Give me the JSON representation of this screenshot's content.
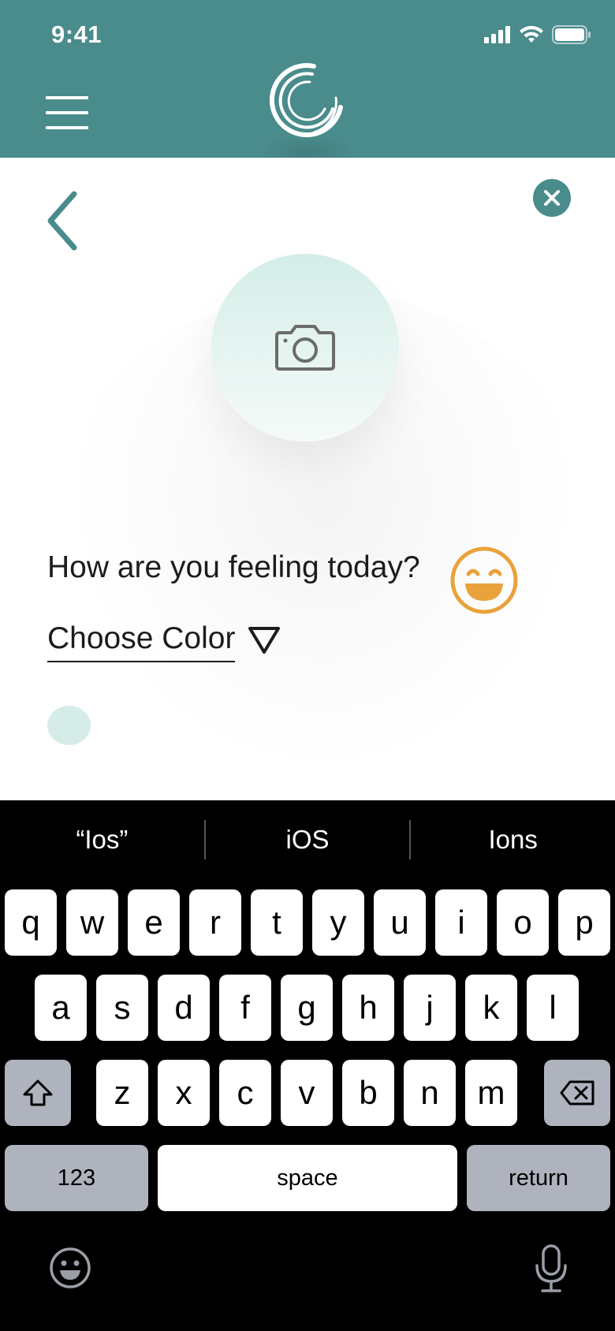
{
  "status_bar": {
    "time": "9:41",
    "icons": [
      "signal-icon",
      "wifi-icon",
      "battery-icon"
    ]
  },
  "header": {
    "menu_icon": "hamburger-menu-icon",
    "logo_icon": "swirl-logo-icon"
  },
  "colors": {
    "header_bg": "#4a8b8c",
    "accent_teal": "#4a8b8c",
    "photo_circle": "#d4ede8",
    "emoji_orange": "#e9a23b",
    "color_dot": "#d6ece8",
    "keyboard_bg": "#000000",
    "key_light": "#ffffff",
    "key_dark": "#aeb3bd"
  },
  "content": {
    "back_icon": "chevron-left-icon",
    "close_icon": "close-icon",
    "photo_icon": "camera-icon",
    "question": "How are you feeling today?",
    "mood_icon": "smiling-face-icon",
    "choose_color_label": "Choose Color",
    "dropdown_icon": "triangle-down-icon"
  },
  "keyboard": {
    "suggestions": [
      "“Ios”",
      "iOS",
      "Ions"
    ],
    "row1": [
      "q",
      "w",
      "e",
      "r",
      "t",
      "y",
      "u",
      "i",
      "o",
      "p"
    ],
    "row2": [
      "a",
      "s",
      "d",
      "f",
      "g",
      "h",
      "j",
      "k",
      "l"
    ],
    "row3": [
      "z",
      "x",
      "c",
      "v",
      "b",
      "n",
      "m"
    ],
    "shift_icon": "shift-icon",
    "delete_icon": "backspace-icon",
    "numbers_label": "123",
    "space_label": "space",
    "return_label": "return",
    "emoji_icon": "emoji-keyboard-icon",
    "mic_icon": "microphone-icon"
  }
}
